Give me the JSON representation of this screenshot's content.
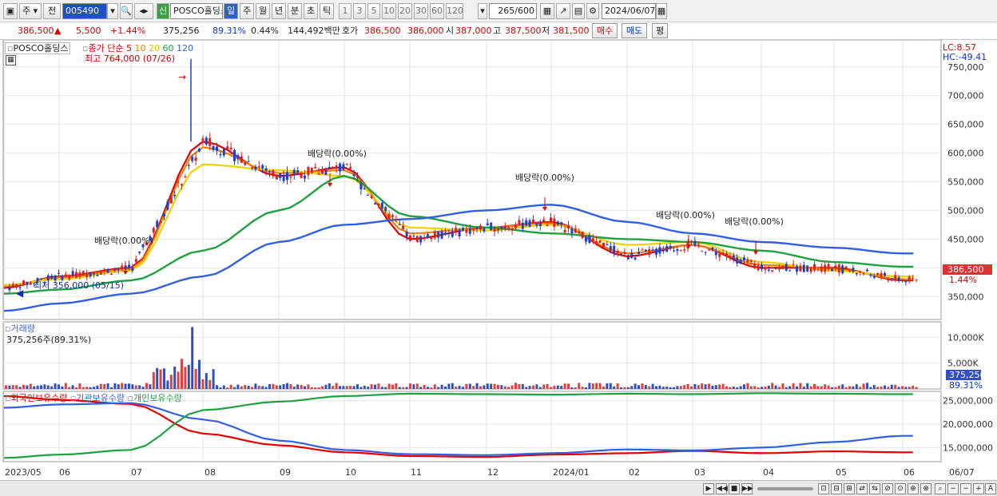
{
  "toolbar": {
    "market_label": "주",
    "prev_label": "전",
    "code": "005490",
    "name_badge": "신",
    "stock_name": "POSCO홀딩스",
    "periods": [
      "일",
      "주",
      "월",
      "년",
      "분",
      "초",
      "틱"
    ],
    "active_period": "일",
    "minute_steps": [
      "1",
      "3",
      "5",
      "10",
      "20",
      "30",
      "60",
      "120"
    ],
    "count_value": "265",
    "count_total": "/600",
    "date": "2024/06/07"
  },
  "quote": {
    "price": "386,500",
    "change_arrow": "▲",
    "change": "5,500",
    "change_pct": "+1.44%",
    "volume": "375,256",
    "volume_ratio": "89.31%",
    "turnover": "0.44%",
    "trade_value": "144,492백만",
    "ask_label": "호가",
    "ask": "386,500",
    "bid": "386,000",
    "open_label": "시",
    "open": "387,000",
    "high_label": "고",
    "high": "387,500",
    "low_label": "저",
    "low": "381,500",
    "buy_label": "매수",
    "sell_label": "매도",
    "eval_label": "평"
  },
  "price_panel": {
    "legend_name": "POSCO홀딩스",
    "legend_ma_prefix": "종가 단순",
    "ma_labels": [
      "5",
      "10",
      "20",
      "60",
      "120"
    ],
    "ma_colors": [
      "#e00000",
      "#f08000",
      "#f0d000",
      "#20a040",
      "#3060e0"
    ],
    "lc": "LC:8.57",
    "hc": "HC:-49.41",
    "high_note": "최고 764,000 (07/26)",
    "low_note": "최저 356,000 (05/15)",
    "dividend_label": "배당락(0.00%)",
    "current_price_tag": "386,500",
    "current_pct_tag": "1.44%",
    "y_ticks": [
      "750,000",
      "700,000",
      "650,000",
      "600,000",
      "550,000",
      "500,000",
      "450,000",
      "400,000",
      "350,000"
    ]
  },
  "volume_panel": {
    "title": "거래량",
    "value": "375,256주(89.31%)",
    "y_ticks": [
      "10,000K",
      "5,000K"
    ],
    "current_tag": "375,256",
    "current_pct": "89.31%"
  },
  "holding_panel": {
    "legend": [
      "외국인보유수량",
      "기관보유수량",
      "개인보유수량"
    ],
    "colors": [
      "#e00000",
      "#3060e0",
      "#20a040"
    ],
    "y_ticks": [
      "25,000,000",
      "20,000,000",
      "15,000,000"
    ]
  },
  "x_axis": [
    "2023/05",
    "06",
    "07",
    "08",
    "09",
    "10",
    "11",
    "12",
    "2024/01",
    "02",
    "03",
    "04",
    "05",
    "06",
    "06/07"
  ],
  "chart_data": {
    "type": "candlestick",
    "title": "POSCO홀딩스",
    "ylim": [
      310000,
      790000
    ],
    "x": [
      "2023/05",
      "06",
      "07",
      "08",
      "09",
      "10",
      "11",
      "12",
      "2024/01",
      "02",
      "03",
      "04",
      "05",
      "06"
    ],
    "series": [
      {
        "name": "5",
        "values": [
          365000,
          385000,
          400000,
          620000,
          560000,
          575000,
          450000,
          470000,
          480000,
          420000,
          440000,
          400000,
          400000,
          378000
        ]
      },
      {
        "name": "10",
        "values": [
          368000,
          383000,
          398000,
          610000,
          565000,
          570000,
          460000,
          470000,
          478000,
          425000,
          440000,
          405000,
          398000,
          380000
        ]
      },
      {
        "name": "20",
        "values": [
          370000,
          380000,
          395000,
          580000,
          570000,
          560000,
          470000,
          465000,
          475000,
          440000,
          445000,
          410000,
          395000,
          385000
        ]
      },
      {
        "name": "60",
        "values": [
          355000,
          362000,
          378000,
          430000,
          500000,
          560000,
          490000,
          470000,
          460000,
          450000,
          445000,
          430000,
          410000,
          402000
        ]
      },
      {
        "name": "120",
        "values": [
          325000,
          338000,
          355000,
          385000,
          445000,
          475000,
          485000,
          500000,
          510000,
          480000,
          460000,
          445000,
          435000,
          425000
        ]
      }
    ]
  }
}
